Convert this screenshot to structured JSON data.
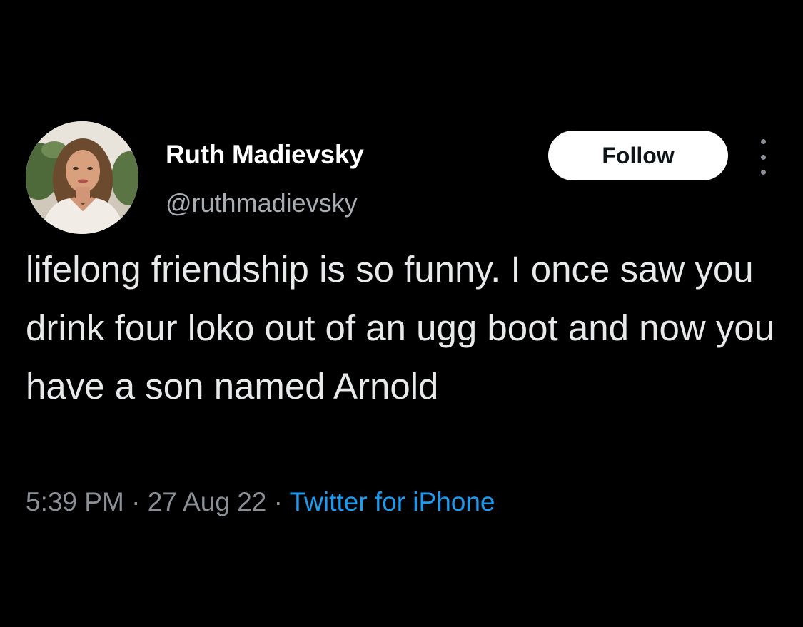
{
  "tweet": {
    "author": {
      "display_name": "Ruth Madievsky",
      "handle": "@ruthmadievsky",
      "avatar_icon": "profile-photo-avatar"
    },
    "follow_label": "Follow",
    "more_icon": "more-options-vertical-icon",
    "text": "lifelong friendship is so funny. I once saw you drink four loko out of an ugg boot and now you have a son named Arnold",
    "time": "5:39 PM",
    "separator": "·",
    "date": "27 Aug 22",
    "source": "Twitter for iPhone"
  },
  "colors": {
    "background": "#000000",
    "text": "#e7e9ea",
    "secondary_text": "#8b9096",
    "link": "#1d9bf0",
    "button_bg": "#ffffff",
    "button_text": "#0f1419"
  }
}
